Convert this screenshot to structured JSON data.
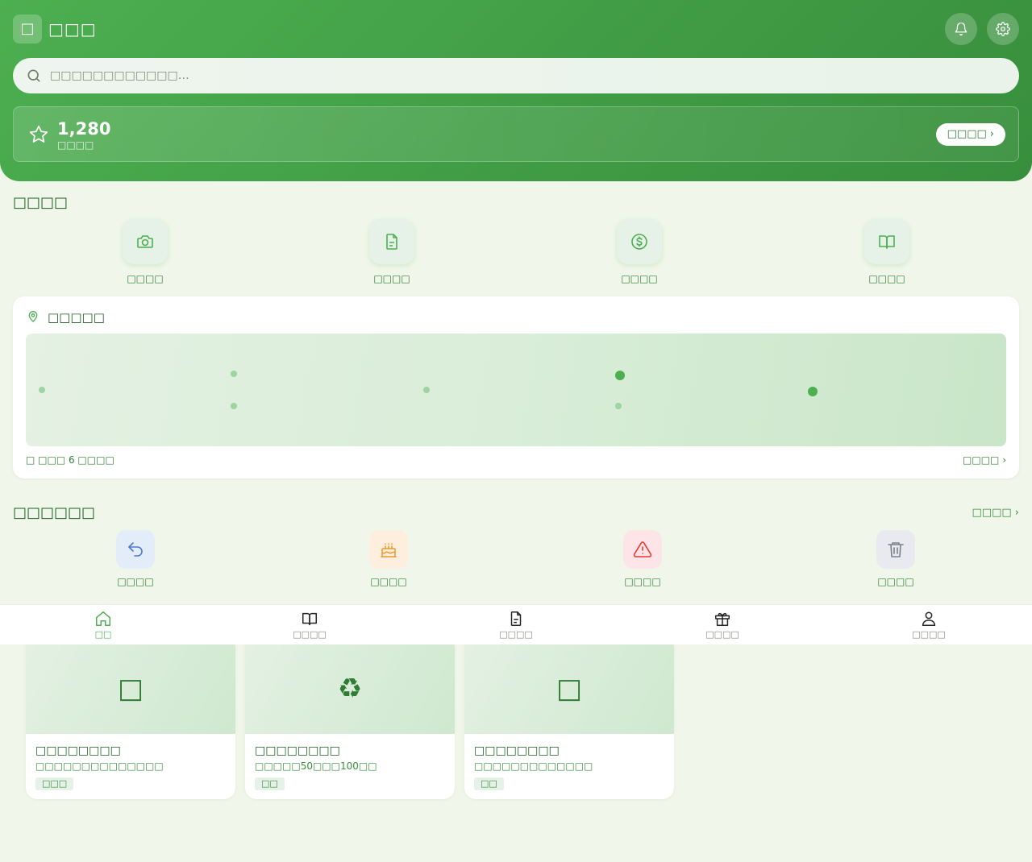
{
  "header": {
    "logo_glyph": "□",
    "app_title": "□□□",
    "notification_icon": "bell-icon",
    "settings_icon": "gear-icon"
  },
  "search": {
    "placeholder": "□□□□□□□□□□□□…",
    "icon": "search-icon"
  },
  "points": {
    "value": "1,280",
    "label": "□□□□",
    "button_label": "□□□□",
    "button_chevron": "›",
    "icon": "star-icon"
  },
  "quick_actions": {
    "title": "□□□□",
    "items": [
      {
        "label": "□□□□",
        "icon": "camera-icon"
      },
      {
        "label": "□□□□",
        "icon": "document-icon"
      },
      {
        "label": "□□□□",
        "icon": "dollar-icon"
      },
      {
        "label": "□□□□",
        "icon": "book-icon"
      }
    ]
  },
  "map": {
    "title": "□□□□□",
    "icon": "map-pin-icon",
    "footer_left": "□ □□□ 6 □□□□",
    "footer_right": "□□□□ ›"
  },
  "process": {
    "title": "□□□□□□",
    "view_all": "□□□□ ›",
    "items": [
      {
        "label": "□□□□",
        "icon": "undo-arrow-icon",
        "bg": "#e3edfa",
        "color": "#4a7bd0"
      },
      {
        "label": "□□□□",
        "icon": "cake-icon",
        "bg": "#fdeedd",
        "color": "#f09a2c"
      },
      {
        "label": "□□□□",
        "icon": "warning-icon",
        "bg": "#fde4e6",
        "color": "#e53935"
      },
      {
        "label": "□□□□",
        "icon": "trash-icon",
        "bg": "#e8eaef",
        "color": "#7b7f88"
      }
    ]
  },
  "cards": [
    {
      "image_glyph": "□",
      "title": "□□□□□□□□",
      "desc": "□□□□□□□□□□□□□□",
      "tag": "□□□"
    },
    {
      "image_glyph": "♻",
      "title": "□□□□□□□□",
      "desc": "□□□□□50□□□100□□",
      "tag": "□□"
    },
    {
      "image_glyph": "□",
      "title": "□□□□□□□□",
      "desc": "□□□□□□□□□□□□□",
      "tag": "□□"
    }
  ],
  "bottom_nav": [
    {
      "label": "□□",
      "icon": "home-icon",
      "active": true
    },
    {
      "label": "□□□□",
      "icon": "book-icon",
      "active": false
    },
    {
      "label": "□□□□",
      "icon": "document-icon",
      "active": false
    },
    {
      "label": "□□□□",
      "icon": "gift-icon",
      "active": false
    },
    {
      "label": "□□□□",
      "icon": "user-icon",
      "active": false
    }
  ],
  "colors": {
    "brand": "#4caf50",
    "brand_dark": "#388e3c",
    "text_dark": "#1b5e20",
    "page_bg": "#f0f6e9"
  }
}
